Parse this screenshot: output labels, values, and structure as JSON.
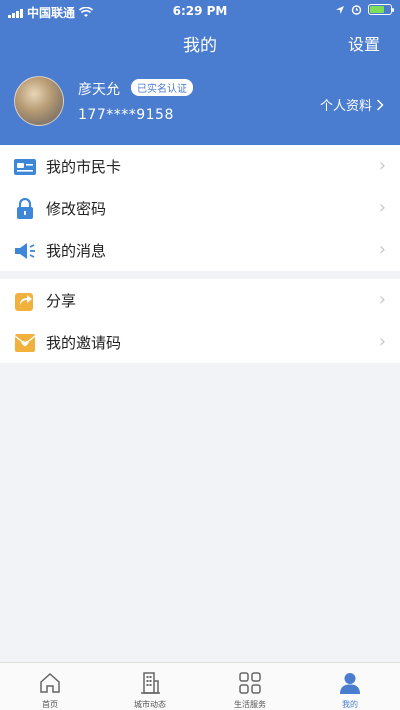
{
  "status_bar": {
    "carrier": "中国联通",
    "time": "6:29 PM"
  },
  "header": {
    "title": "我的",
    "settings_label": "设置"
  },
  "profile": {
    "name": "彦天允",
    "verified_badge": "已实名认证",
    "phone": "177****9158",
    "info_link": "个人资料"
  },
  "menu_group_1": [
    {
      "label": "我的市民卡",
      "icon": "card-icon"
    },
    {
      "label": "修改密码",
      "icon": "lock-icon"
    },
    {
      "label": "我的消息",
      "icon": "speaker-icon"
    }
  ],
  "menu_group_2": [
    {
      "label": "分享",
      "icon": "share-icon"
    },
    {
      "label": "我的邀请码",
      "icon": "invite-envelope-icon"
    }
  ],
  "tabbar": [
    {
      "label": "首页",
      "icon": "home-icon"
    },
    {
      "label": "城市动态",
      "icon": "building-icon"
    },
    {
      "label": "生活服务",
      "icon": "grid-icon"
    },
    {
      "label": "我的",
      "icon": "user-icon",
      "active": true
    }
  ],
  "colors": {
    "primary": "#4a7ccf",
    "card_icon": "#3d86d8",
    "lock_icon": "#3d86d8",
    "speaker_icon": "#3d86d8",
    "share_icon": "#f0b23c",
    "invite_icon": "#f0b23c"
  }
}
